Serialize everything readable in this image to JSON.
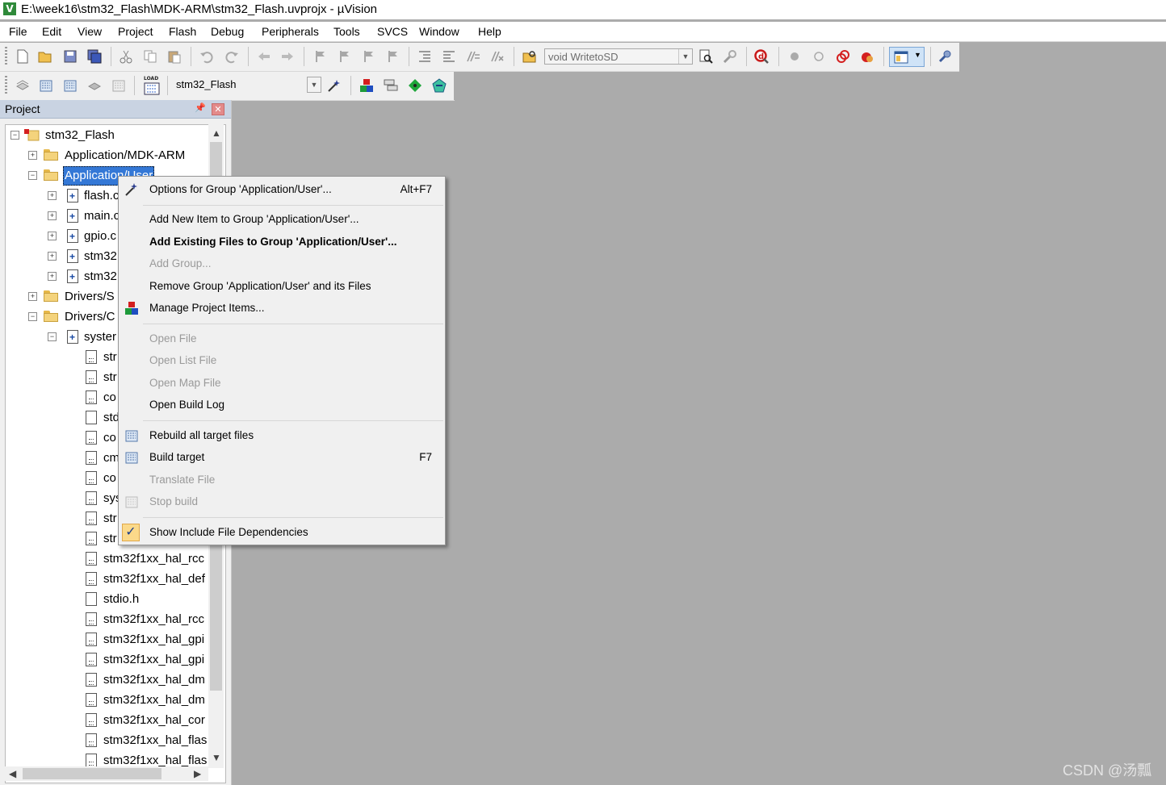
{
  "window": {
    "title": "E:\\week16\\stm32_Flash\\MDK-ARM\\stm32_Flash.uvprojx - µVision",
    "app_icon_letter": "V"
  },
  "menubar": {
    "items": [
      "File",
      "Edit",
      "View",
      "Project",
      "Flash",
      "Debug",
      "Peripherals",
      "Tools",
      "SVCS",
      "Window",
      "Help"
    ]
  },
  "toolbar": {
    "function_combo": "void WritetoSD",
    "target_combo": "stm32_Flash",
    "load_label": "LOAD"
  },
  "project_panel": {
    "title": "Project",
    "tree": {
      "root": "stm32_Flash",
      "rows": [
        "Application/MDK-ARM",
        "Application/User",
        "flash.c",
        "main.c",
        "gpio.c",
        "stm32",
        "stm32",
        "Drivers/S",
        "Drivers/C",
        "syster",
        "str",
        "str",
        "co",
        "std",
        "co",
        "cm",
        "co",
        "sys",
        "str",
        "str",
        "stm32f1xx_hal_rcc",
        "stm32f1xx_hal_def",
        "stdio.h",
        "stm32f1xx_hal_rcc",
        "stm32f1xx_hal_gpi",
        "stm32f1xx_hal_gpi",
        "stm32f1xx_hal_dm",
        "stm32f1xx_hal_dm",
        "stm32f1xx_hal_cor",
        "stm32f1xx_hal_flas",
        "stm32f1xx_hal_flas"
      ]
    }
  },
  "context_menu": {
    "items": [
      {
        "label": "Options for Group 'Application/User'...",
        "shortcut": "Alt+F7",
        "icon": "magic-wand-icon",
        "enabled": true
      },
      {
        "label": "Add New  Item to Group 'Application/User'...",
        "enabled": true
      },
      {
        "label": "Add Existing Files to Group 'Application/User'...",
        "enabled": true,
        "bold": true
      },
      {
        "label": "Add Group...",
        "enabled": false
      },
      {
        "label": "Remove Group 'Application/User' and its Files",
        "enabled": true
      },
      {
        "label": "Manage Project Items...",
        "icon": "manage-items-icon",
        "enabled": true
      },
      {
        "label": "Open File",
        "enabled": false
      },
      {
        "label": "Open List File",
        "enabled": false
      },
      {
        "label": "Open Map File",
        "enabled": false
      },
      {
        "label": "Open Build Log",
        "enabled": true
      },
      {
        "label": "Rebuild all target files",
        "icon": "rebuild-icon",
        "enabled": true
      },
      {
        "label": "Build target",
        "shortcut": "F7",
        "icon": "build-icon",
        "enabled": true
      },
      {
        "label": "Translate File",
        "enabled": false
      },
      {
        "label": "Stop build",
        "icon": "stop-build-icon",
        "enabled": false
      },
      {
        "label": "Show Include File Dependencies",
        "icon": "checkmark-icon",
        "enabled": true,
        "checked": true
      }
    ]
  },
  "watermark": "CSDN @汤瓢",
  "colors": {
    "selection": "#3478d6",
    "workspace": "#ababab",
    "panel_header": "#c9d3e2"
  }
}
